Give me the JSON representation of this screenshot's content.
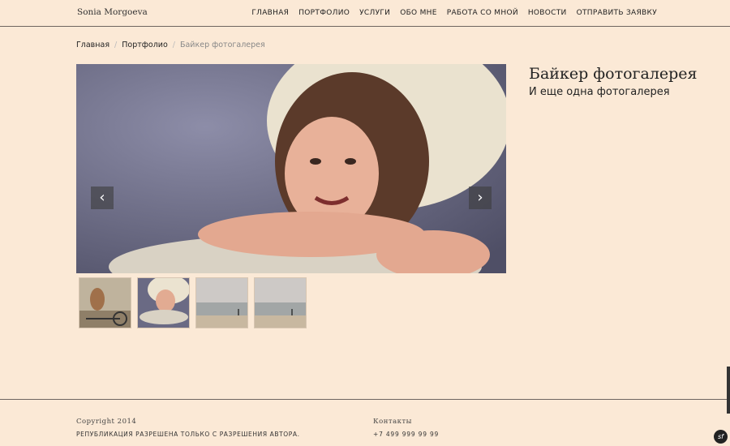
{
  "header": {
    "brand": "Sonia Morgoeva",
    "nav": [
      "ГЛАВНАЯ",
      "ПОРТФОЛИО",
      "УСЛУГИ",
      "ОБО МНЕ",
      "РАБОТА СО МНОЙ",
      "НОВОСТИ",
      "ОТПРАВИТЬ ЗАЯВКУ"
    ]
  },
  "breadcrumb": {
    "items": [
      "Главная",
      "Портфолио",
      "Байкер фотогалерея"
    ],
    "separator": "/"
  },
  "gallery": {
    "prev_icon": "chevron-left-icon",
    "next_icon": "chevron-right-icon",
    "prev_glyph": "‹",
    "next_glyph": "›"
  },
  "page": {
    "title": "Байкер фотогалерея",
    "subtitle": "И еще одна фотогалерея"
  },
  "footer": {
    "copyright": "Copyright 2014",
    "rights": "РЕПУБЛИКАЦИЯ РАЗРЕШЕНА ТОЛЬКО С РАЗРЕШЕНИЯ АВТОРА.",
    "contacts_label": "Контакты",
    "phone": "+7 499 999 99 99"
  },
  "badge": {
    "glyph": "sf"
  }
}
